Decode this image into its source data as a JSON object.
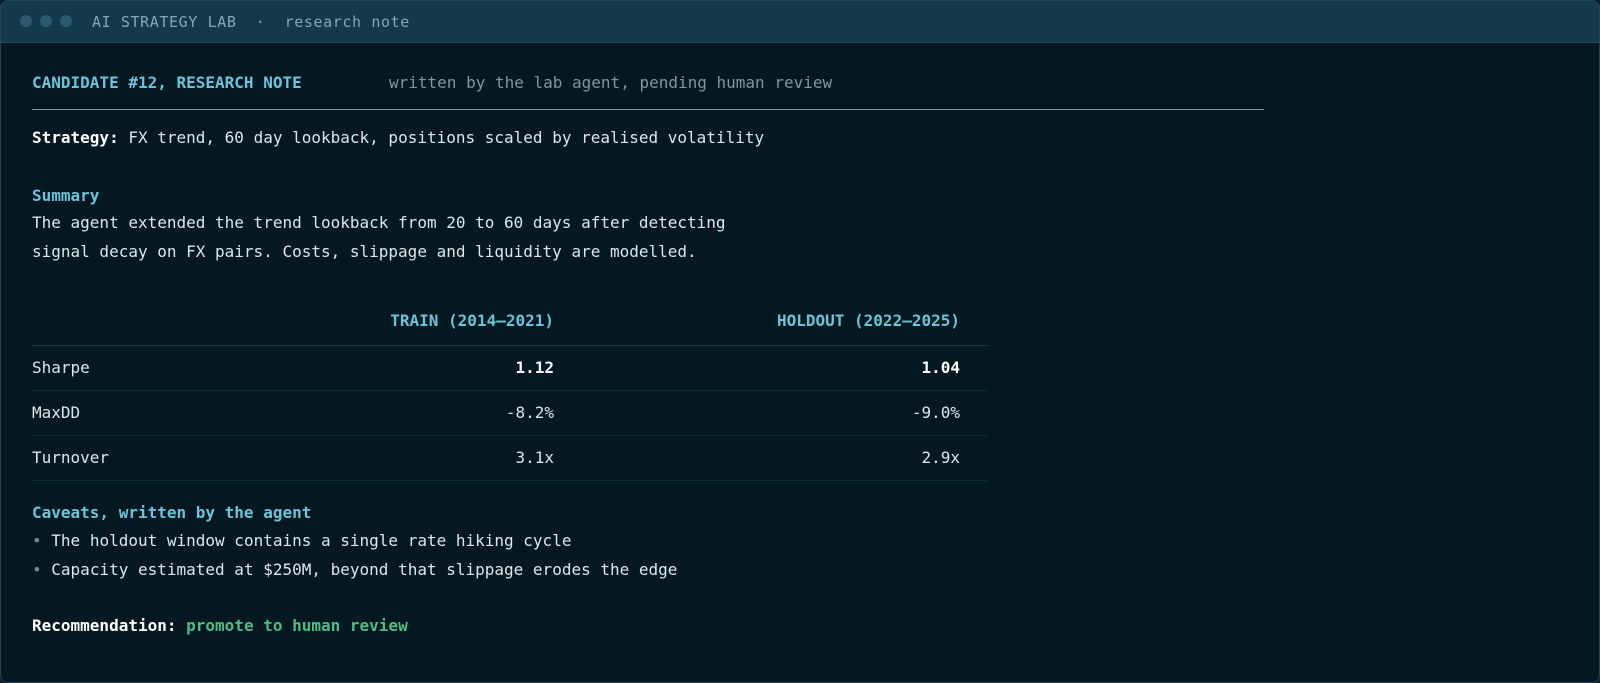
{
  "window": {
    "title": "AI STRATEGY LAB",
    "separator": "·",
    "subtitle": "research note"
  },
  "note": {
    "heading": "CANDIDATE #12, RESEARCH NOTE",
    "byline": "written by the lab agent, pending human review",
    "strategy_label": "Strategy:",
    "strategy_value": "FX trend, 60 day lookback, positions scaled by realised volatility",
    "summary_title": "Summary",
    "summary_lines": [
      "The agent extended the trend lookback from 20 to 60 days after detecting",
      "signal decay on FX pairs. Costs, slippage and liquidity are modelled."
    ],
    "metrics": {
      "columns": [
        "TRAIN (2014–2021)",
        "HOLDOUT (2022–2025)"
      ],
      "rows": [
        {
          "label": "Sharpe",
          "train": "1.12",
          "holdout": "1.04",
          "emphasis": true
        },
        {
          "label": "MaxDD",
          "train": "-8.2%",
          "holdout": "-9.0%",
          "emphasis": false
        },
        {
          "label": "Turnover",
          "train": "3.1x",
          "holdout": "2.9x",
          "emphasis": false
        }
      ]
    },
    "caveats_title": "Caveats, written by the agent",
    "bullet_glyph": "•",
    "caveats": [
      "The holdout window contains a single rate hiking cycle",
      "Capacity estimated at $250M, beyond that slippage erodes the edge"
    ],
    "recommendation_label": "Recommendation:",
    "recommendation_value": "promote to human review"
  },
  "colors": {
    "accent": "#6cc4da",
    "positive": "#4fbe85",
    "background": "#031820",
    "titlebar": "#133a4c"
  }
}
